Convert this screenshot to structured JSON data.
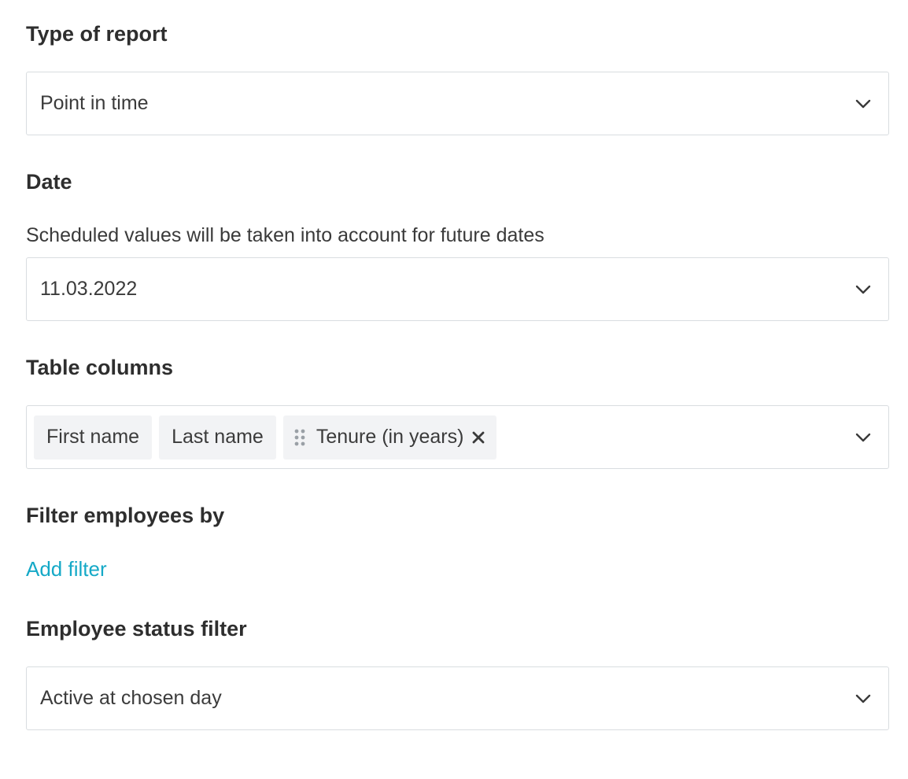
{
  "report_type": {
    "label": "Type of report",
    "value": "Point in time",
    "icon": "chevron-down-icon"
  },
  "date": {
    "label": "Date",
    "helper": "Scheduled values will be taken into account for future dates",
    "value": "11.03.2022",
    "icon": "chevron-down-icon"
  },
  "table_columns": {
    "label": "Table columns",
    "chips": [
      {
        "label": "First name"
      },
      {
        "label": "Last name"
      },
      {
        "label": "Tenure (in years)"
      }
    ],
    "icon": "chevron-down-icon"
  },
  "filter": {
    "label": "Filter employees by",
    "add_link": "Add filter"
  },
  "status_filter": {
    "label": "Employee status filter",
    "value": "Active at chosen day",
    "icon": "chevron-down-icon"
  },
  "colors": {
    "link": "#15a9c7",
    "border": "#d9dde0",
    "chip_bg": "#f2f3f5"
  }
}
